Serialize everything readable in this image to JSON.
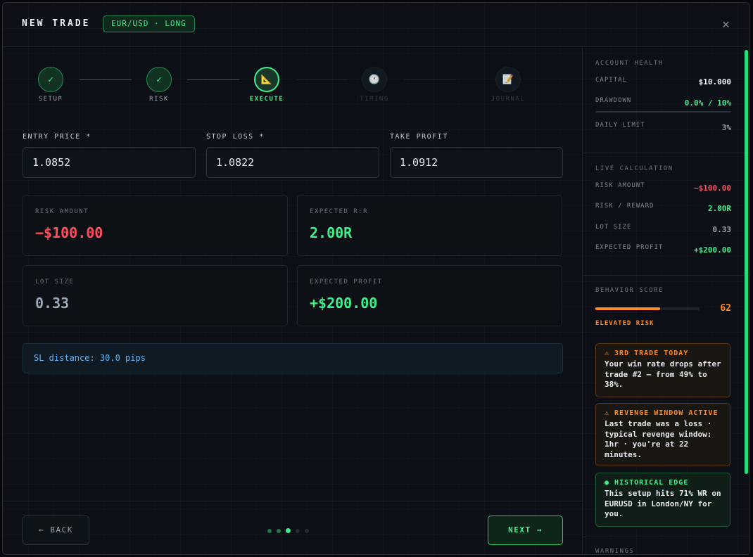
{
  "header": {
    "title": "NEW TRADE",
    "pair_badge": "EUR/USD · LONG",
    "close_glyph": "✕"
  },
  "stepper": {
    "steps": [
      {
        "label": "SETUP",
        "state": "done",
        "glyph": "✓"
      },
      {
        "label": "RISK",
        "state": "done",
        "glyph": "✓"
      },
      {
        "label": "EXECUTE",
        "state": "active",
        "glyph": "📐"
      },
      {
        "label": "TIMING",
        "state": "pending",
        "glyph": "🕐"
      },
      {
        "label": "JOURNAL",
        "state": "pending",
        "glyph": "📝"
      }
    ]
  },
  "form": {
    "entry_label": "ENTRY PRICE *",
    "entry_value": "1.0852",
    "stop_label": "STOP LOSS *",
    "stop_value": "1.0822",
    "tp_label": "TAKE PROFIT",
    "tp_value": "1.0912"
  },
  "metrics": {
    "risk_amount_label": "RISK AMOUNT",
    "risk_amount_value": "−$100.00",
    "rr_label": "EXPECTED R:R",
    "rr_value": "2.00R",
    "lot_label": "LOT SIZE",
    "lot_value": "0.33",
    "profit_label": "EXPECTED PROFIT",
    "profit_value": "+$200.00"
  },
  "info": {
    "sl_distance": "SL distance: 30.0 pips"
  },
  "footer": {
    "back_label": "← BACK",
    "next_label": "NEXT →",
    "page_dots": {
      "total": 5,
      "current": 3
    }
  },
  "sidebar": {
    "account_health": {
      "title": "ACCOUNT HEALTH",
      "capital_label": "CAPITAL",
      "capital_value": "$10.000",
      "drawdown_label": "DRAWDOWN",
      "drawdown_value": "0.0% / 10%",
      "daily_limit_label": "DAILY LIMIT",
      "daily_limit_value": "3%"
    },
    "live_calc": {
      "title": "LIVE CALCULATION",
      "risk_amount_label": "RISK AMOUNT",
      "risk_amount_value": "−$100.00",
      "rr_label": "RISK / REWARD",
      "rr_value": "2.00R",
      "lot_label": "LOT SIZE",
      "lot_value": "0.33",
      "profit_label": "EXPECTED PROFIT",
      "profit_value": "+$200.00"
    },
    "behavior": {
      "title": "BEHAVIOR SCORE",
      "score": "62",
      "score_fraction": 0.62,
      "status": "ELEVATED RISK"
    },
    "cards": [
      {
        "title": "⚠ 3RD TRADE TODAY",
        "body": "Your win rate drops after trade #2 — from 49% to 38%."
      },
      {
        "title": "⚠ REVENGE WINDOW ACTIVE",
        "body": "Last trade was a loss · typical revenge window: 1hr · you're at 22 minutes."
      },
      {
        "title": "● HISTORICAL EDGE",
        "body": "This setup hits 71% WR on EURUSD in London/NY for you."
      }
    ],
    "warnings_title": "WARNINGS"
  },
  "colors": {
    "accent_green": "#3ef08b",
    "danger_red": "#ff4d5e",
    "warning_orange": "#ff8a1f",
    "info_blue": "#5cb6ff"
  }
}
